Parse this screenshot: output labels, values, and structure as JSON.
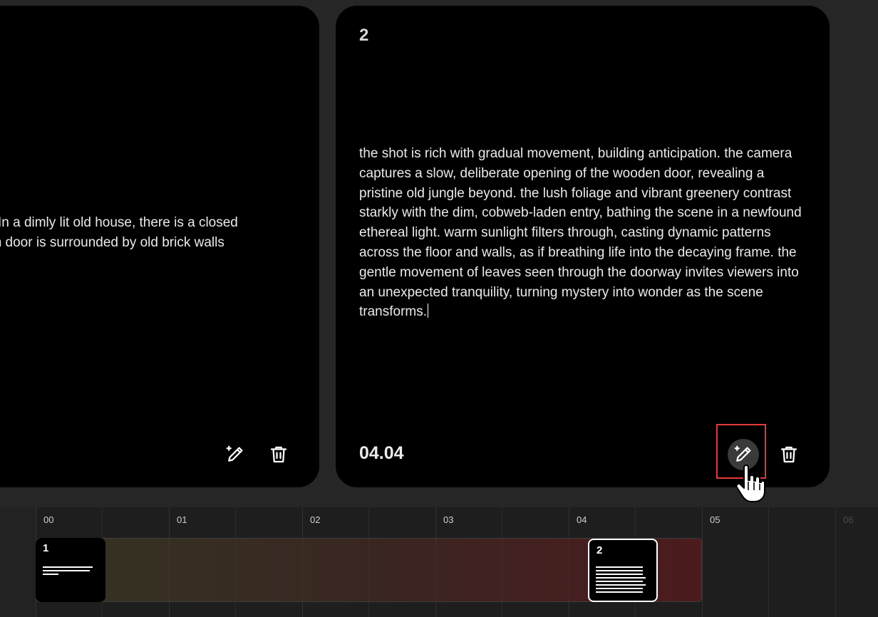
{
  "cards": [
    {
      "text_lines": [
        "hot. In a dimly lit old house, there is a closed",
        "oden door is surrounded by old brick walls"
      ]
    },
    {
      "index": "2",
      "text": "the shot is rich with gradual movement, building anticipation. the camera captures a slow, deliberate opening of the wooden door, revealing a pristine old jungle beyond. the lush foliage and vibrant greenery contrast starkly with the dim, cobweb-laden entry, bathing the scene in a newfound ethereal light. warm sunlight filters through, casting dynamic patterns across the floor and walls, as if breathing life into the decaying frame. the gentle movement of leaves seen through the doorway invites viewers into an unexpected tranquility, turning mystery into wonder as the scene transforms.",
      "time": "04.04"
    }
  ],
  "icons": {
    "edit": "magic-pencil-icon",
    "delete": "trash-icon"
  },
  "timeline": {
    "ticks": [
      "00",
      "01",
      "02",
      "03",
      "04",
      "05",
      "06"
    ],
    "clips": [
      {
        "label": "1"
      },
      {
        "label": "2"
      }
    ]
  },
  "colors": {
    "highlight": "#e23a3a",
    "background": "#262626",
    "card": "#000000"
  }
}
